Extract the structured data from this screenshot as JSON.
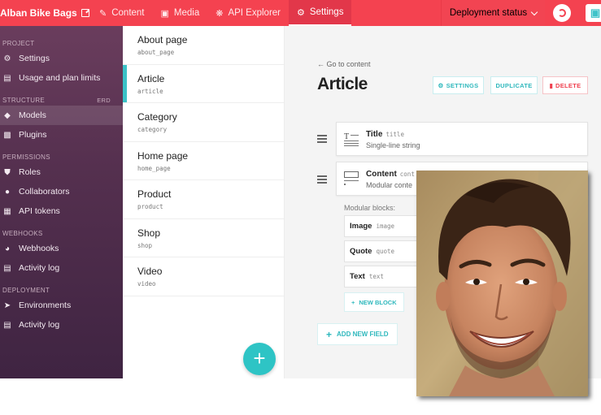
{
  "topbar": {
    "brand": "Alban Bike Bags",
    "tabs": [
      {
        "label": "Content",
        "icon": "feather-icon"
      },
      {
        "label": "Media",
        "icon": "image-icon"
      },
      {
        "label": "API Explorer",
        "icon": "api-icon"
      },
      {
        "label": "Settings",
        "icon": "gear-icon",
        "active": true
      }
    ],
    "deployment_label": "Deployment status"
  },
  "sidebar": {
    "sections": [
      {
        "title": "PROJECT",
        "items": [
          {
            "label": "Settings",
            "icon": "gear-icon"
          },
          {
            "label": "Usage and plan limits",
            "icon": "chart-icon"
          }
        ]
      },
      {
        "title": "STRUCTURE",
        "extra": "ERD",
        "items": [
          {
            "label": "Models",
            "icon": "models-icon",
            "active": true
          },
          {
            "label": "Plugins",
            "icon": "puzzle-icon"
          }
        ]
      },
      {
        "title": "PERMISSIONS",
        "items": [
          {
            "label": "Roles",
            "icon": "shield-icon"
          },
          {
            "label": "Collaborators",
            "icon": "users-icon"
          },
          {
            "label": "API tokens",
            "icon": "token-icon"
          }
        ]
      },
      {
        "title": "WEBHOOKS",
        "items": [
          {
            "label": "Webhooks",
            "icon": "webhook-icon"
          },
          {
            "label": "Activity log",
            "icon": "document-icon"
          }
        ]
      },
      {
        "title": "DEPLOYMENT",
        "items": [
          {
            "label": "Environments",
            "icon": "rocket-icon"
          },
          {
            "label": "Activity log",
            "icon": "document-icon"
          }
        ]
      }
    ]
  },
  "models": [
    {
      "name": "About page",
      "api_key": "about_page"
    },
    {
      "name": "Article",
      "api_key": "article",
      "active": true
    },
    {
      "name": "Category",
      "api_key": "category"
    },
    {
      "name": "Home page",
      "api_key": "home_page"
    },
    {
      "name": "Product",
      "api_key": "product"
    },
    {
      "name": "Shop",
      "api_key": "shop"
    },
    {
      "name": "Video",
      "api_key": "video"
    }
  ],
  "main": {
    "goto": "← Go to content",
    "title": "Article",
    "buttons": {
      "settings": "SETTINGS",
      "duplicate": "DUPLICATE",
      "delete": "DELETE"
    },
    "fields": [
      {
        "name": "Title",
        "api_key": "title",
        "type": "Single-line string"
      },
      {
        "name": "Content",
        "api_key": "cont",
        "type": "Modular conte"
      }
    ],
    "modular_blocks_label": "Modular blocks:",
    "blocks": [
      {
        "name": "Image",
        "api_key": "image"
      },
      {
        "name": "Quote",
        "api_key": "quote"
      },
      {
        "name": "Text",
        "api_key": "text"
      }
    ],
    "new_block": "NEW BLOCK",
    "add_field": "ADD NEW FIELD"
  },
  "colors": {
    "topbar": "#f44250",
    "accent": "#2ec4c5",
    "sidebar": "#55304f",
    "danger": "#ef3f4e"
  }
}
